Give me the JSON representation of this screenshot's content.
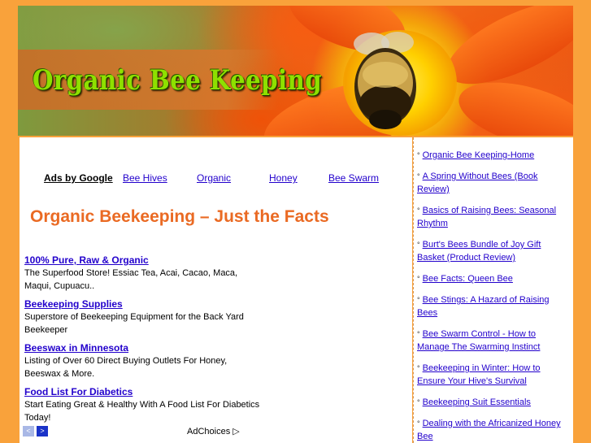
{
  "site": {
    "title": "Organic Bee Keeping"
  },
  "ad_nav": {
    "label": "Ads by Google",
    "links": [
      "Bee Hives",
      "Organic",
      "Honey",
      "Bee Swarm"
    ]
  },
  "page": {
    "heading": "Organic Beekeeping – Just the Facts"
  },
  "ads": [
    {
      "title": "100% Pure, Raw & Organic",
      "desc": "The Superfood Store! Essiac Tea, Acai, Cacao, Maca, Maqui, Cupuacu.."
    },
    {
      "title": "Beekeeping Supplies",
      "desc": "Superstore of Beekeeping Equipment for the Back Yard Beekeeper"
    },
    {
      "title": "Beeswax in Minnesota",
      "desc": "Listing of Over 60 Direct Buying Outlets For Honey, Beeswax & More."
    },
    {
      "title": "Food List For Diabetics",
      "desc": "Start Eating Great & Healthy With A Food List For Diabetics Today!"
    }
  ],
  "ad_controls": {
    "prev": "<",
    "next": ">",
    "adchoices": "AdChoices ▷"
  },
  "sidebar": {
    "links": [
      "Organic Bee Keeping-Home",
      "A Spring Without Bees (Book Review)",
      "Basics of Raising Bees: Seasonal Rhythm",
      "Burt's Bees Bundle of Joy Gift Basket (Product Review)",
      "Bee Facts: Queen Bee",
      "Bee Stings: A Hazard of Raising Bees",
      "Bee Swarm Control - How to Manage The Swarming Instinct",
      "Beekeeping in Winter: How to Ensure Your Hive's Survival",
      "Beekeeping Suit Essentials",
      "Dealing with the Africanized Honey Bee"
    ]
  },
  "colors": {
    "background": "#f9a23b",
    "heading": "#ea6a23",
    "link": "#2200cc",
    "title_green": "#8ee000"
  }
}
